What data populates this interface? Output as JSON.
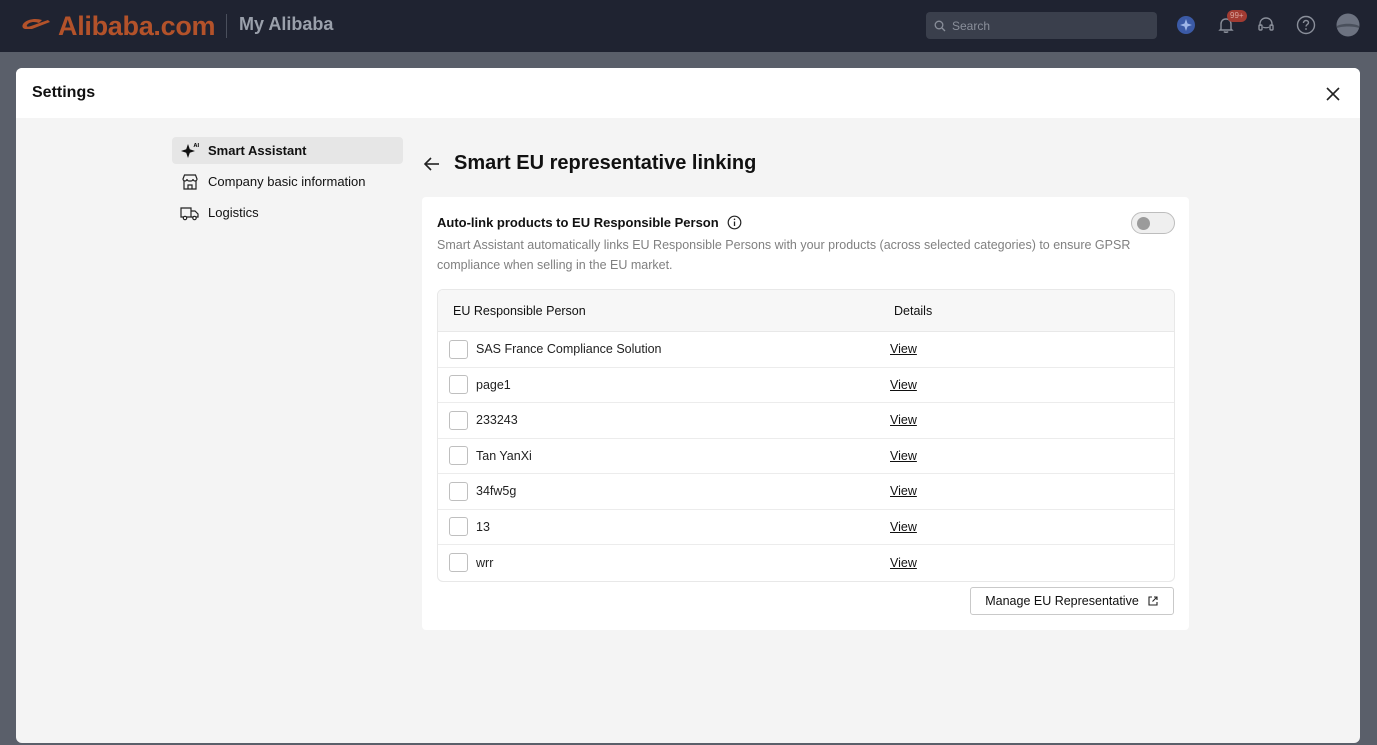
{
  "topbar": {
    "logo_text": "Alibaba.com",
    "section_title": "My Alibaba",
    "search_placeholder": "Search",
    "notification_badge": "99+",
    "icons": [
      "sparkle-icon",
      "bell-icon",
      "headset-icon",
      "help-icon",
      "avatar"
    ]
  },
  "modal": {
    "title": "Settings"
  },
  "sidebar": {
    "items": [
      {
        "label": "Smart Assistant",
        "icon": "sparkle-icon",
        "active": true
      },
      {
        "label": "Company basic information",
        "icon": "store-icon",
        "active": false
      },
      {
        "label": "Logistics",
        "icon": "truck-icon",
        "active": false
      }
    ]
  },
  "main": {
    "title": "Smart EU representative linking",
    "auto_link": {
      "title": "Auto-link products to EU Responsible Person",
      "enabled": false,
      "description": "Smart Assistant automatically links EU Responsible Persons with your products (across selected categories) to ensure GPSR compliance when selling in the EU market."
    },
    "table": {
      "headers": [
        "EU Responsible Person",
        "Details"
      ],
      "rows": [
        {
          "name": "SAS France Compliance Solution",
          "action": "View"
        },
        {
          "name": "page1",
          "action": "View"
        },
        {
          "name": "233243",
          "action": "View"
        },
        {
          "name": "Tan YanXi",
          "action": "View"
        },
        {
          "name": "34fw5g",
          "action": "View"
        },
        {
          "name": "13",
          "action": "View"
        },
        {
          "name": "wrr",
          "action": "View"
        }
      ]
    },
    "manage_button": "Manage EU Representative"
  },
  "colors": {
    "topbar_bg": "#1f2331",
    "logo": "#b3522a",
    "modal_bg": "#f4f4f4"
  }
}
